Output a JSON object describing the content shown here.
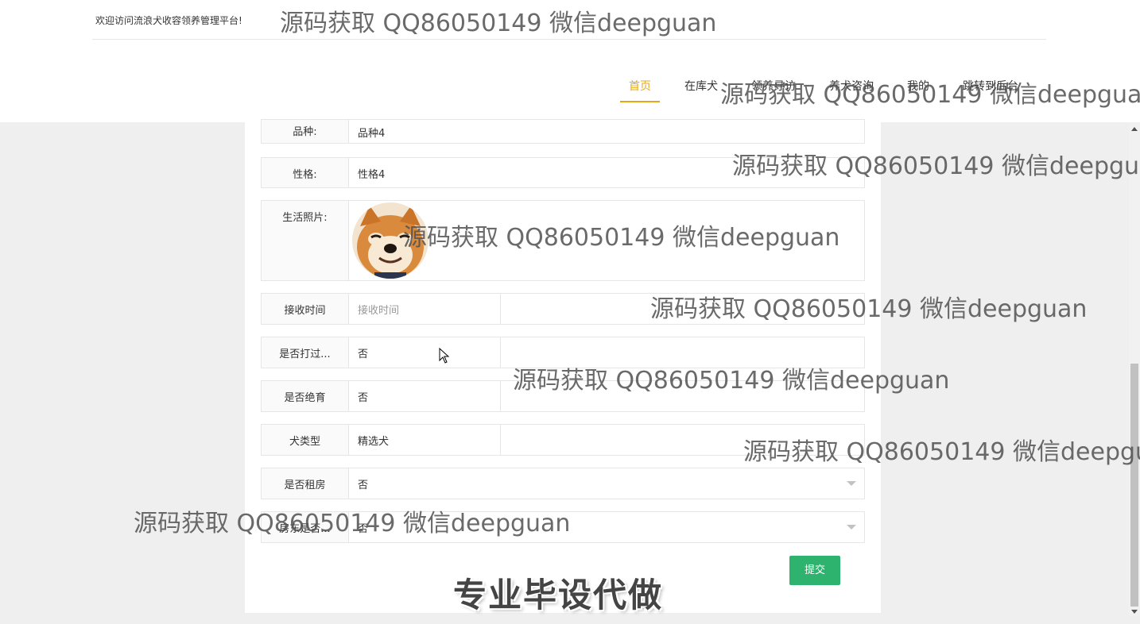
{
  "header": {
    "welcome": "欢迎访问流浪犬收容领养管理平台!"
  },
  "nav": {
    "items": [
      {
        "label": "首页"
      },
      {
        "label": "在库犬"
      },
      {
        "label": "领养寻访"
      },
      {
        "label": "养犬咨询"
      },
      {
        "label": "我的"
      },
      {
        "label": "跳转到后台"
      }
    ],
    "active_index": 0,
    "active_color": "#e6a817"
  },
  "form": {
    "breed": {
      "label": "品种:",
      "value": "品种4"
    },
    "temperament": {
      "label": "性格:",
      "value": "性格4"
    },
    "photo": {
      "label": "生活照片:"
    },
    "receive_time": {
      "label": "接收时间",
      "placeholder": "接收时间"
    },
    "vaccinated": {
      "label": "是否打过...",
      "value": "否"
    },
    "sterilized": {
      "label": "是否绝育",
      "value": "否"
    },
    "dog_type": {
      "label": "犬类型",
      "value": "精选犬"
    },
    "renting": {
      "label": "是否租房",
      "value": "否"
    },
    "landlord": {
      "label": "房东是否...",
      "value": "否"
    },
    "submit_label": "提交",
    "submit_color": "#2db36e"
  },
  "slogan": "专业毕设代做",
  "watermark": "源码获取 QQ86050149 微信deepguan"
}
